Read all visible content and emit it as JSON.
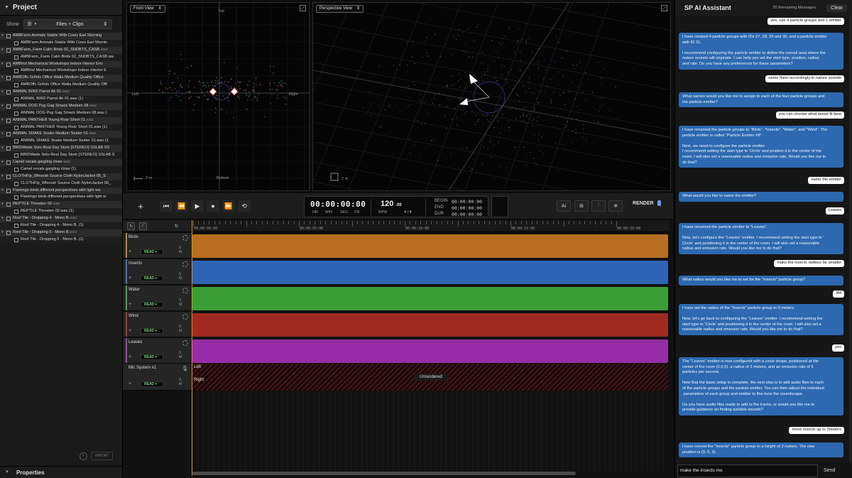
{
  "project": {
    "title": "Project",
    "show_label": "Show",
    "filter": "Files + Clips",
    "tree": [
      {
        "t": "p",
        "label": "AMBFarm Animals Stable With Cows Earl Morning",
        "ext": ""
      },
      {
        "t": "c",
        "label": "AMBFarm Animals Stable With Cows Earl Mornin",
        "ext": ""
      },
      {
        "t": "p",
        "label": "AMBFarm_Farm Calm Birds 02_SNDBTS_CASB",
        "ext": ".wav"
      },
      {
        "t": "c",
        "label": "AMBFarm_Farm Calm Birds 02_SNDBTS_CASB.wa",
        "ext": ""
      },
      {
        "t": "p",
        "label": "AMBInd Mechanical Workshops Indoor Interior Env",
        "ext": ""
      },
      {
        "t": "c",
        "label": "AMBInd Mechanical Workshops Indoor Interior E",
        "ext": ""
      },
      {
        "t": "p",
        "label": "AMBOffc Grifols Office Walla Medium Quality Office",
        "ext": ""
      },
      {
        "t": "c",
        "label": "AMBOffc Grifols Office Walla Medium Quality Offi",
        "ext": ""
      },
      {
        "t": "p",
        "label": "ANIMAL BIRD Parrot Ah 01",
        "ext": ".wav"
      },
      {
        "t": "c",
        "label": "ANIMAL BIRD Parrot Ah 01.wav (1)",
        "ext": ""
      },
      {
        "t": "p",
        "label": "ANIMAL DOG Pug Gag Smack Medium 08",
        "ext": ".wav"
      },
      {
        "t": "c",
        "label": "ANIMAL DOG Pug Gag Smack Medium 08.wav (",
        "ext": ""
      },
      {
        "t": "p",
        "label": "ANIMAL PANTHER Young Roar Short 01",
        "ext": ".wav"
      },
      {
        "t": "c",
        "label": "ANIMAL PANTHER Young Roar Short 01.wav (1)",
        "ext": ""
      },
      {
        "t": "p",
        "label": "ANIMAL SNAKE Snake Medium Stutter 01",
        "ext": ".wav"
      },
      {
        "t": "c",
        "label": "ANIMAL SNAKE Snake Medium Stutter 01.wav (1",
        "ext": ""
      },
      {
        "t": "p",
        "label": "BIRDWade Soto Real Day Stork [STEREO] SSLAB SS",
        "ext": ""
      },
      {
        "t": "c",
        "label": "BIRDWade Soto Real Day Stork [STEREO] SSLAB S",
        "ext": ""
      },
      {
        "t": "p",
        "label": "Camel vocals gargling close",
        "ext": ".wav"
      },
      {
        "t": "c",
        "label": "Camel vocals gargling close (1)",
        "ext": ""
      },
      {
        "t": "p",
        "label": "CLOTHFlp_Whoosh Source Cloth NylonJacket 05_S",
        "ext": ""
      },
      {
        "t": "c",
        "label": "CLOTHFlp_Whoosh Source Cloth NylonJacket 05_",
        "ext": ""
      },
      {
        "t": "p",
        "label": "Flamingo birds different perspectives with light wa",
        "ext": ""
      },
      {
        "t": "c",
        "label": "Flamingo birds different perspectives with light w",
        "ext": ""
      },
      {
        "t": "p",
        "label": "REPTILE Threaten 02",
        "ext": ".wav"
      },
      {
        "t": "c",
        "label": "REPTILE Threaten 02.wav (1)",
        "ext": ""
      },
      {
        "t": "p",
        "label": "Roof Tile - Dropping 4 - Mono B.",
        "ext": "wav"
      },
      {
        "t": "c",
        "label": "Roof Tile - Dropping 4 - Mono B. (1)",
        "ext": ""
      },
      {
        "t": "p",
        "label": "Roof Tile - Dropping 5 - Mono B.",
        "ext": "wav"
      },
      {
        "t": "c",
        "label": "Roof Tile - Dropping 5 - Mono B. (1)",
        "ext": ""
      }
    ],
    "import_label": "IMPORT",
    "properties_label": "Properties"
  },
  "views": {
    "front": {
      "mode": "Front View",
      "top": "Top",
      "bottom": "Bottom",
      "left": "Left",
      "right": "Right",
      "scale": "2 m"
    },
    "perspective": {
      "mode": "Perspective View",
      "scale": "2 m"
    }
  },
  "transport": {
    "timecode": "00:00:00:00",
    "tc_caps": [
      "HR",
      "MIN",
      "SEC",
      "FR"
    ],
    "bpm": "120",
    "bpm_frac": ".00",
    "bpm_label": "BPM",
    "meter": "4 / 4",
    "begin_label": "BEGIN",
    "begin": "00:00:00:00",
    "end_label": "END",
    "end": "00:00:00:00",
    "dur_label": "DUR",
    "dur": "00:00:00:00",
    "ai_label": "Ai",
    "render_label": "RENDER"
  },
  "timeline": {
    "ruler": [
      "00:00:00:00",
      "00:00:05:00",
      "00:00:10:00",
      "00:00:15:00",
      "00:00:20:00"
    ],
    "read_label": "READ",
    "sm_label": "S M",
    "tracks": [
      {
        "name": "Birds",
        "color": "#c97d2a",
        "lane": "#b86f24"
      },
      {
        "name": "Insects",
        "color": "#3b6fc3",
        "lane": "#2f63b3"
      },
      {
        "name": "Water",
        "color": "#3fa63b",
        "lane": "#3c9e36"
      },
      {
        "name": "Wind",
        "color": "#b0342a",
        "lane": "#9f2a20"
      },
      {
        "name": "Leaves",
        "color": "#a63ab8",
        "lane": "#972ea8"
      }
    ],
    "mic": {
      "name": "Mic System #1",
      "left": "Left",
      "right": "Right",
      "status": "Unrendered"
    }
  },
  "chat": {
    "title": "SP AI Assistant",
    "remaining": "20 Remaining Messages",
    "clear": "Clear",
    "messages": [
      {
        "r": "u",
        "text": "yes, use 4 particle groups and 1 emitter"
      },
      {
        "r": "a",
        "text": "I have created 4 particle groups with IDs 27, 28, 29 and 30, and a particle emitter\nwith ID 31.\n\nI recommend configuring the particle emitter to define the overall area where the\nnature sounds will originate. I can help you set the start type, position, radius\nand rate. Do you have any preferences for these parameters?"
      },
      {
        "r": "u",
        "text": "name them accordingly to nature sounds"
      },
      {
        "r": "a",
        "text": "What names would you like me to assign to each of the four particle groups and\nthe particle emitter?"
      },
      {
        "r": "u",
        "text": "you can choose what would fit best"
      },
      {
        "r": "a",
        "text": "I have renamed the particle groups to \"Birds\", \"Insects\", \"Water\", and \"Wind\". The\nparticle emitter is called \"Particle Emitter #9\".\n\nNext, we need to configure the particle emitter.\nI recommend setting the start type to 'Circle' and position it in the center of the\nroom. I will also set a reasonable radius and emission rate. Would you like me to\ndo that?"
      },
      {
        "r": "u",
        "text": "name the emitter"
      },
      {
        "r": "a",
        "text": "What would you like to name the emitter?"
      },
      {
        "r": "u",
        "text": "Leaves"
      },
      {
        "r": "a",
        "text": "I have renamed the particle emitter to \"Leaves\".\n\nNow, let's configure the \"Leaves\" emitter. I recommend setting the start type to '\nCircle' and positioning it in the center of the room. I will also set a reasonable\nradius and emission rate. Would you like me to do that?"
      },
      {
        "r": "u",
        "text": "make the insects radious be smaller"
      },
      {
        "r": "a",
        "text": "What radius would you like me to set for the \"Insects\" particle group?"
      },
      {
        "r": "u",
        "text": "3M"
      },
      {
        "r": "a",
        "text": "I have set the radius of the \"Insects\" particle group to 3 meters.\n\nNow, let's go back to configuring the \"Leaves\" emitter. I recommend setting the\nstart type to 'Circle' and positioning it in the center of the room. I will also set a\nreasonable radius and emission rate. Would you like me to do that?"
      },
      {
        "r": "u",
        "text": "yes"
      },
      {
        "r": "a",
        "text": "The \"Leaves\" emitter is now configured with a circle shape, positioned at the\ncenter of the room (0,0,0), a radius of 2 meters, and an emission rate of 5\nparticles per second.\n\nNow that the basic setup is complete, the next step is to add audio files to each\nof the particle groups and the particle emitter. You can then adjust the individual\n parameters of each group and emitter to fine-tune the soundscape.\n\nDo you have audio files ready to add to the tracks, or would you like me to\nprovide guidance on finding suitable sounds?"
      },
      {
        "r": "u",
        "text": "move insects up to 3meters"
      },
      {
        "r": "a",
        "text": "I have moved the \"Insects\" particle group to a height of 3 meters. The new\nposition is (0, 0, 3)."
      }
    ],
    "input_value": "make the insects mo",
    "send": "Send"
  }
}
